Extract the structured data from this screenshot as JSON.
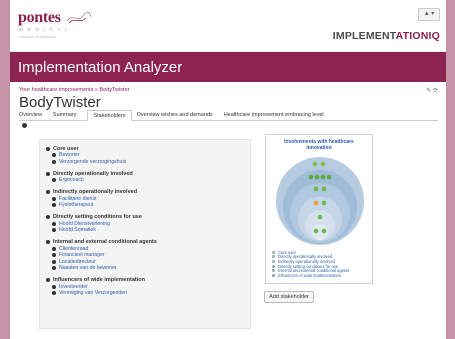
{
  "header": {
    "brand_name": "pontes",
    "brand_subtitle": "M E D I C A L",
    "brand_tagline": "innovation in healthcare",
    "product_logo_prefix": "IMPLEMENT",
    "product_logo_accent": "ATIONIQ",
    "user_menu": "▲ ▾",
    "banner_title": "Implementation Analyzer"
  },
  "page": {
    "breadcrumb": "Your healthcare improvements » BodyTwister",
    "title": "BodyTwister",
    "tools": "✎ ⟳"
  },
  "tabs": [
    {
      "label": "Overview",
      "active": false
    },
    {
      "label": "Summary",
      "active": false
    },
    {
      "label": "Stakeholders",
      "active": true
    },
    {
      "label": "Overview wishes and demands",
      "active": false
    },
    {
      "label": "Healthcare improvement embracing level",
      "active": false
    }
  ],
  "stakeholders": [
    {
      "group": "Core user",
      "items": [
        "Bewoner",
        "Verzorgende verzorgingshuis"
      ]
    },
    {
      "group": "Directly operationally involved",
      "items": [
        "Ergocoach"
      ]
    },
    {
      "group": "Indirectly operationally involved",
      "items": [
        "Facilitaire dienst",
        "Fysiotherapeut"
      ]
    },
    {
      "group": "Directly setting conditions for use",
      "items": [
        "Hoofd Dienstverlening",
        "Hoofd Somatiek"
      ]
    },
    {
      "group": "Internal and external conditional agents",
      "items": [
        "Cliëntenraad",
        "Financieel manager",
        "Locatiedirecteur",
        "Naasten van de bewoner"
      ]
    },
    {
      "group": "Influencers of wide implementation",
      "items": [
        "Investeerder",
        "Vereniging van Verzorgenden"
      ]
    }
  ],
  "chart": {
    "title": "Involvements with healthcare innovation",
    "legend": [
      {
        "label": "Core user",
        "color": "#e0e8f0"
      },
      {
        "label": "Directly operationally involved",
        "color": "#d4e0ec"
      },
      {
        "label": "Indirectly operationally involved",
        "color": "#c4d6e8"
      },
      {
        "label": "Directly setting conditions for use",
        "color": "#b0c8e0"
      },
      {
        "label": "Internal and external conditional agents",
        "color": "#94b4d4"
      },
      {
        "label": "Influencers of wide implementation",
        "color": "#7aa0c8"
      }
    ]
  },
  "actions": {
    "add_stakeholder": "Add stakeholder"
  }
}
